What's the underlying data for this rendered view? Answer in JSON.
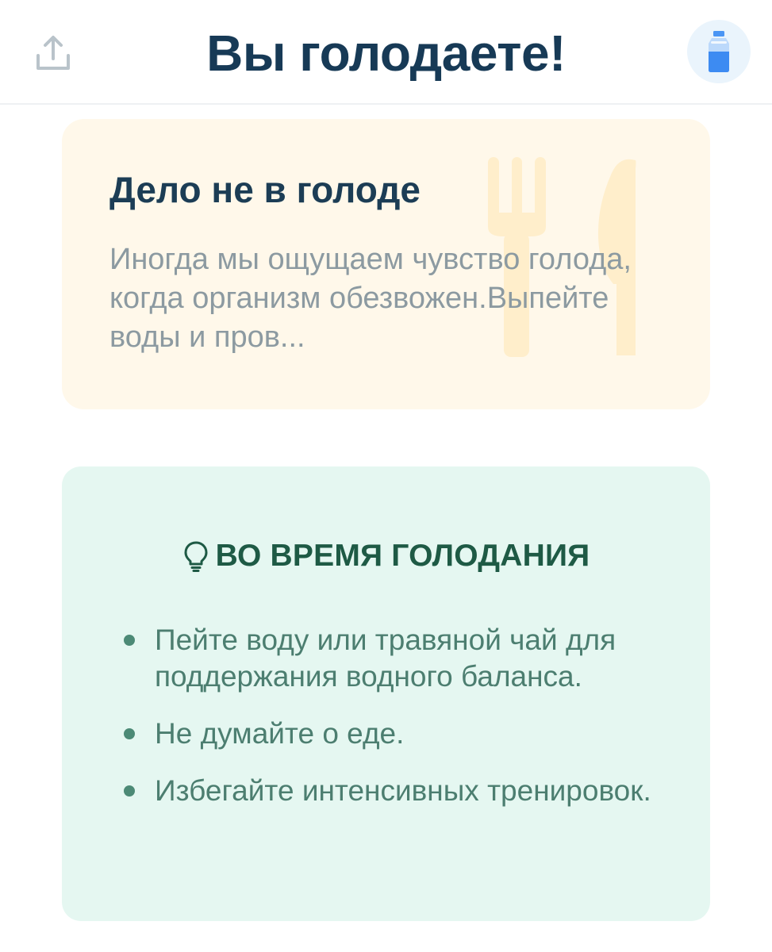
{
  "header": {
    "title": "Вы голодаете!",
    "share_icon": "share-icon",
    "water_icon": "water-bottle-icon"
  },
  "hunger_card": {
    "title": "Дело не в голоде",
    "text": "Иногда мы ощущаем чувство голода, когда организм обезвожен.Выпейте воды и пров...",
    "icon": "cutlery-icon",
    "background": "#fff8ea"
  },
  "tips": {
    "title": "ВО ВРЕМЯ ГОЛОДАНИЯ",
    "icon": "lightbulb-icon",
    "background": "#e5f7f1",
    "items": [
      "Пейте воду или травяной чай для поддержания водного баланса.",
      "Не думайте о еде.",
      "Избегайте интенсивных тренировок."
    ]
  },
  "colors": {
    "title": "#173a56",
    "accent_blue": "#3d8bf2",
    "tips_text": "#4c7e70"
  }
}
